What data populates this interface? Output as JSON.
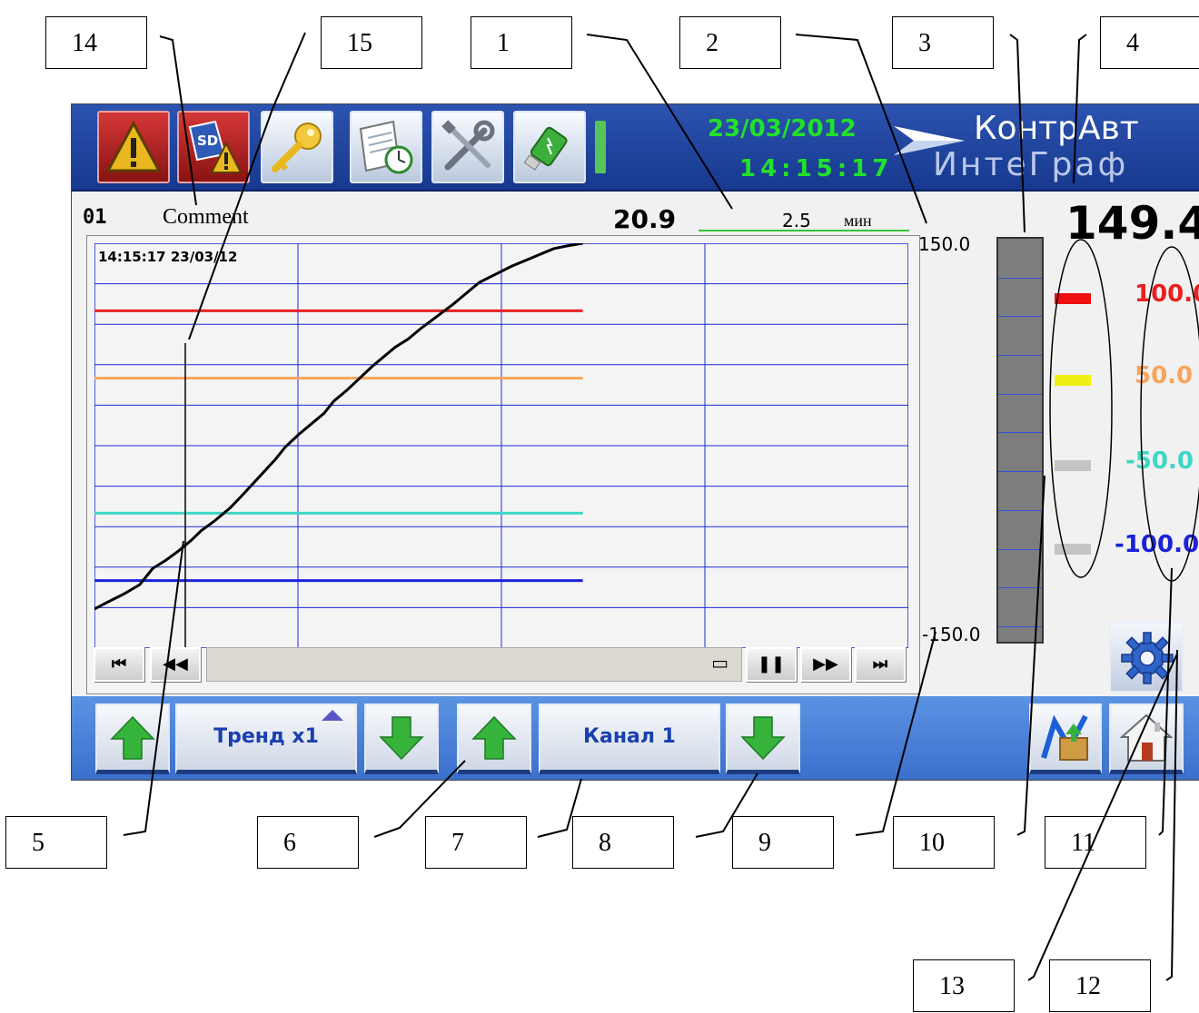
{
  "callouts": [
    "14",
    "15",
    "1",
    "2",
    "3",
    "4",
    "5",
    "6",
    "7",
    "8",
    "9",
    "10",
    "11",
    "13",
    "12"
  ],
  "topbar": {
    "date": "23/03/2012",
    "time": "14:15:17",
    "logo_name": "КонтрАвт",
    "logo_sub": "ИнтеГраф"
  },
  "channel": {
    "number": "01",
    "comment": "Comment",
    "current_value": "20.9",
    "big_value": "149.4"
  },
  "time_scale": {
    "value": "2.5",
    "unit": "мин"
  },
  "scale": {
    "max": "150.0",
    "min": "-150.0"
  },
  "chart_data": {
    "type": "line",
    "stamp": "14:15:17  23/03/12",
    "ylim": [
      -150,
      150
    ],
    "xlim": [
      0,
      100
    ],
    "grid": true,
    "series": [
      {
        "values": [
          [
            0,
            -121
          ],
          [
            4,
            -116
          ],
          [
            9,
            -110
          ],
          [
            14,
            -103
          ],
          [
            16,
            -97
          ],
          [
            18,
            -91
          ],
          [
            22,
            -85
          ],
          [
            26,
            -78
          ],
          [
            30,
            -70
          ],
          [
            33,
            -63
          ],
          [
            37,
            -56
          ],
          [
            42,
            -46
          ],
          [
            46,
            -36
          ],
          [
            51,
            -23
          ],
          [
            56,
            -10
          ],
          [
            59,
            -1
          ],
          [
            63,
            8
          ],
          [
            67,
            16
          ],
          [
            71,
            24
          ],
          [
            74,
            33
          ],
          [
            78,
            41
          ],
          [
            82,
            50
          ],
          [
            86,
            59
          ],
          [
            90,
            67
          ],
          [
            93,
            73
          ],
          [
            97,
            79
          ],
          [
            101,
            87
          ],
          [
            106,
            96
          ],
          [
            111,
            105
          ],
          [
            115,
            113
          ],
          [
            119,
            121
          ],
          [
            124,
            127
          ],
          [
            129,
            133
          ],
          [
            134,
            138
          ],
          [
            138,
            142
          ],
          [
            142,
            146
          ],
          [
            146,
            148
          ],
          [
            151,
            150
          ]
        ],
        "color": "#000000"
      }
    ],
    "limits": [
      {
        "value": 100,
        "color": "#e82020"
      },
      {
        "value": 50,
        "color": "#f7a55a"
      },
      {
        "value": -50,
        "color": "#3cd7c6"
      },
      {
        "value": -100,
        "color": "#1a22d8"
      }
    ]
  },
  "limits_panel": [
    {
      "label": "100.0",
      "color": "#e82020",
      "mark_color": "#ee1010"
    },
    {
      "label": "50.0",
      "color": "#f7a55a",
      "mark_color": "#f1ee14"
    },
    {
      "label": "-50.0",
      "color": "#3cd7c6",
      "mark_color": "#c4c4c4"
    },
    {
      "label": "-100.0",
      "color": "#1a22d8",
      "mark_color": "#c4c4c4"
    }
  ],
  "playback": {
    "first": "⏮",
    "rewind": "◀◀",
    "frame": "▭",
    "pause": "❚❚",
    "forward": "▶▶",
    "last": "⏭"
  },
  "bottombar": {
    "trend_label": "Тренд х1",
    "channel_label": "Канал 1"
  },
  "colors": {
    "topbar": "#1f45a0",
    "bottombar": "#4a82d8",
    "grid": "#1a2ad8",
    "accent_green": "#22e12a"
  }
}
